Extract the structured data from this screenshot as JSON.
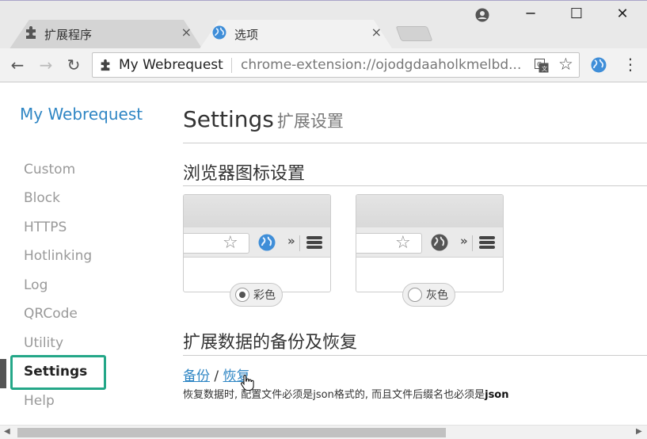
{
  "browser": {
    "tabs": [
      {
        "label": "扩展程序",
        "close": "×"
      },
      {
        "label": "选项",
        "close": "×"
      }
    ],
    "window_controls": {
      "minimize": "─",
      "maximize": "☐",
      "close": "✕"
    },
    "nav": {
      "back": "←",
      "forward": "→",
      "reload": "↻"
    },
    "omnibox": {
      "title": "My Webrequest",
      "url": "chrome-extension://ojodgdaaholkmelbd..."
    },
    "star": "☆",
    "menu": "⋮"
  },
  "sidebar": {
    "brand": "My Webrequest",
    "items": [
      {
        "label": "Custom"
      },
      {
        "label": "Block"
      },
      {
        "label": "HTTPS"
      },
      {
        "label": "Hotlinking"
      },
      {
        "label": "Log"
      },
      {
        "label": "QRCode"
      },
      {
        "label": "Utility"
      },
      {
        "label": "Settings",
        "active": true
      },
      {
        "label": "Help"
      }
    ]
  },
  "main": {
    "title": "Settings",
    "subtitle": "扩展设置",
    "icon_section": {
      "title": "浏览器图标设置",
      "options": [
        {
          "label": "彩色",
          "checked": true,
          "icon": "color-globe-icon"
        },
        {
          "label": "灰色",
          "checked": false,
          "icon": "gray-globe-icon"
        }
      ]
    },
    "backup_section": {
      "title": "扩展数据的备份及恢复",
      "backup_link": "备份",
      "separator": "/",
      "restore_link": "恢复",
      "note_prefix": "恢复数据时, 配置文件必须是json格式的, 而且文件后缀名也必须是",
      "note_bold": "json"
    }
  },
  "colors": {
    "accent": "#2f86c4",
    "highlight": "#24a788"
  }
}
